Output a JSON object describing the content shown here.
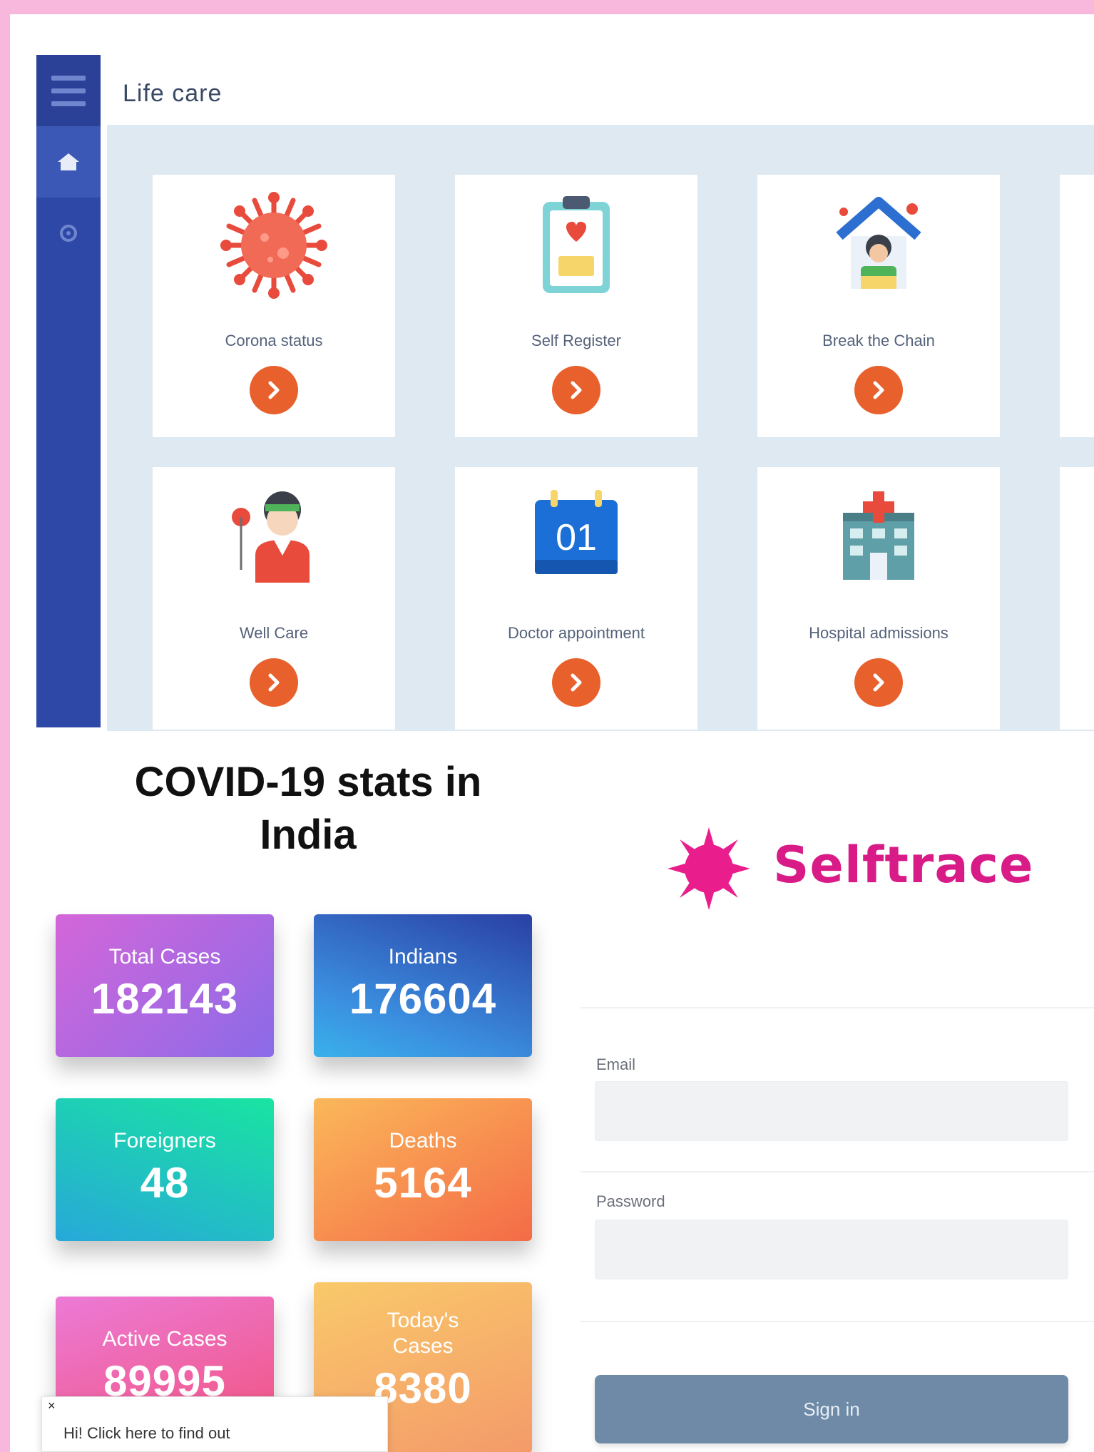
{
  "app": {
    "title": "Life care"
  },
  "sidebar": {
    "items": [
      {
        "icon": "menu-icon"
      },
      {
        "icon": "home-icon"
      },
      {
        "icon": "settings-icon"
      }
    ]
  },
  "tiles": [
    {
      "label": "Corona status",
      "icon": "virus-icon"
    },
    {
      "label": "Self Register",
      "icon": "clipboard-heart-icon"
    },
    {
      "label": "Break the Chain",
      "icon": "stay-home-icon"
    },
    {
      "label": "Well Care",
      "icon": "doctor-icon"
    },
    {
      "label": "Doctor appointment",
      "icon": "calendar-icon",
      "calendar_day": "01"
    },
    {
      "label": "Hospital admissions",
      "icon": "hospital-icon"
    }
  ],
  "stats": {
    "title": "COVID-19 stats in India",
    "cards": [
      {
        "label": "Total Cases",
        "value": "182143"
      },
      {
        "label": "Indians",
        "value": "176604"
      },
      {
        "label": "Foreigners",
        "value": "48"
      },
      {
        "label": "Deaths",
        "value": "5164"
      },
      {
        "label": "Active Cases",
        "value": "89995"
      },
      {
        "label": "Today's Cases",
        "value": "8380"
      }
    ],
    "tooltip": "Hi! Click here to find out"
  },
  "login": {
    "brand": "Selftrace",
    "email_label": "Email",
    "email_value": "",
    "password_label": "Password",
    "password_value": "",
    "signin_label": "Sign in"
  },
  "colors": {
    "sidebar": "#2d48a6",
    "accent_button": "#e8602c",
    "brand": "#d81b87",
    "signin": "#6e8aa6",
    "frame": "#f8b8de"
  }
}
